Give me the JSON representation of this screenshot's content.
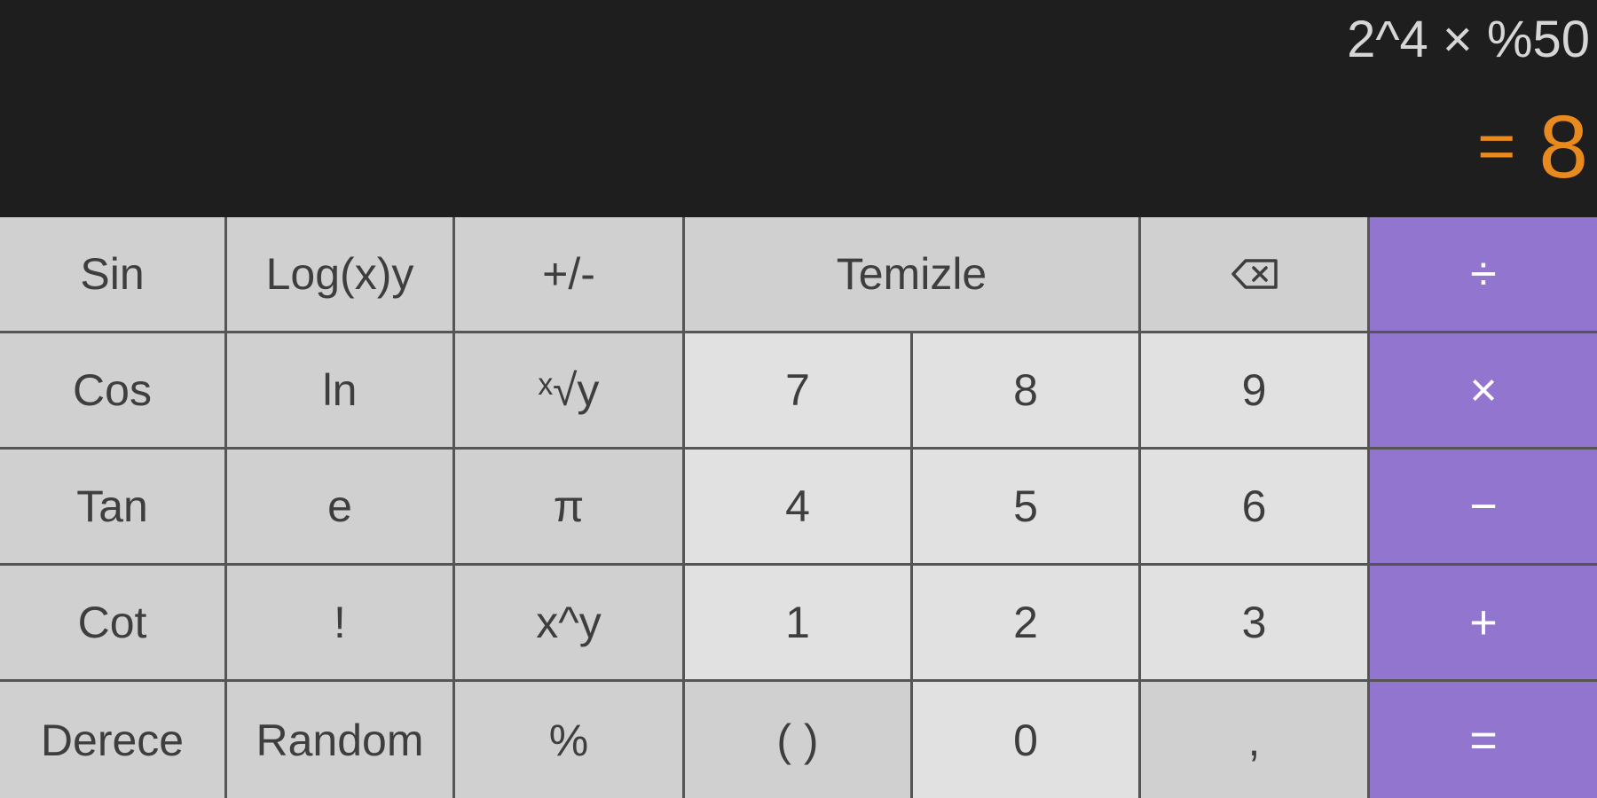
{
  "display": {
    "expression": "2^4 × %50",
    "result_equals": "=",
    "result_value": "8"
  },
  "keys": {
    "sin": "Sin",
    "log_xy": "Log(x)y",
    "plus_minus": "+/-",
    "clear": "Temizle",
    "backspace_icon": "backspace-icon",
    "divide": "÷",
    "cos": "Cos",
    "ln": "ln",
    "root_xy": "ˣ√y",
    "seven": "7",
    "eight": "8",
    "nine": "9",
    "multiply": "×",
    "tan": "Tan",
    "e": "e",
    "pi": "π",
    "four": "4",
    "five": "5",
    "six": "6",
    "minus": "−",
    "cot": "Cot",
    "factorial": "!",
    "power": "x^y",
    "one": "1",
    "two": "2",
    "three": "3",
    "plus": "+",
    "degree": "Derece",
    "random": "Random",
    "percent": "%",
    "parentheses": "( )",
    "zero": "0",
    "decimal": ",",
    "equals": "="
  },
  "colors": {
    "display_background": "#1e1e1e",
    "expression_text": "#d6d6d6",
    "result_text": "#e88a1e",
    "function_key": "#d0d0d0",
    "number_key": "#e1e1e1",
    "operator_key": "#9175cf"
  }
}
